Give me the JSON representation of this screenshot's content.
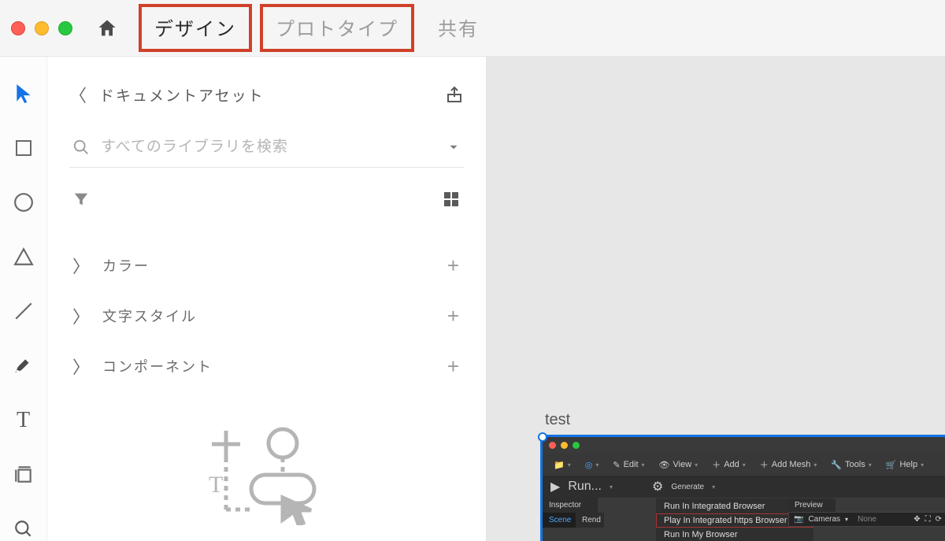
{
  "top": {
    "tabs": {
      "design": "デザイン",
      "prototype": "プロトタイプ",
      "share": "共有"
    }
  },
  "panel": {
    "title": "ドキュメントアセット",
    "search_placeholder": "すべてのライブラリを検索",
    "sections": {
      "color": "カラー",
      "text_style": "文字スタイル",
      "component": "コンポーネント"
    }
  },
  "canvas": {
    "artboard_name": "test",
    "embedded": {
      "toolbar": {
        "edit": "Edit",
        "view": "View",
        "add": "Add",
        "add_mesh": "Add Mesh",
        "tools": "Tools",
        "help": "Help",
        "run": "Run...",
        "generate": "Generate"
      },
      "inspector": "Inspector",
      "tabs": {
        "scene": "Scene",
        "render": "Rend"
      },
      "menu": {
        "run_integrated": "Run In Integrated Browser",
        "play_https": "Play In Integrated https Browser",
        "run_my": "Run In My Browser"
      },
      "preview": {
        "label": "Preview",
        "cameras": "Cameras",
        "none": "None"
      }
    }
  }
}
